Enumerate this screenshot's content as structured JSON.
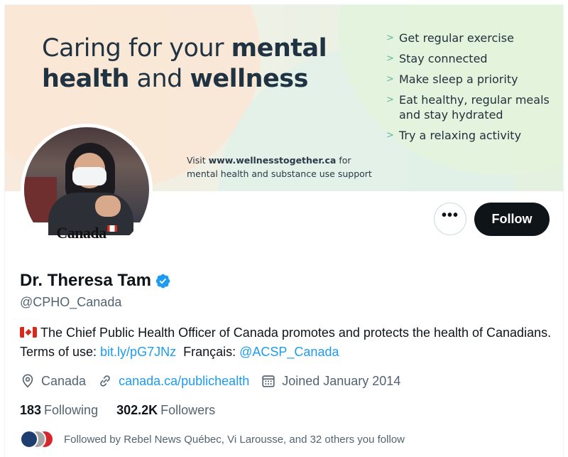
{
  "banner": {
    "title_light_1": "Caring for your ",
    "title_bold_1": "mental",
    "title_bold_2": "health",
    "title_light_2": " and ",
    "title_bold_3": "wellness",
    "tips": [
      "Get regular exercise",
      "Stay connected",
      "Make sleep a priority",
      "Eat healthy, regular meals and stay hydrated",
      "Try a relaxing activity"
    ],
    "tip_marker": ">",
    "visit_prefix": "Visit ",
    "visit_url": "www.wellnesstogether.ca",
    "visit_suffix": " for",
    "visit_line2": "mental health and substance use support"
  },
  "avatar": {
    "wordmark": "Canada"
  },
  "actions": {
    "more_label": "•••",
    "follow_label": "Follow"
  },
  "profile": {
    "name": "Dr. Theresa Tam",
    "handle": "@CPHO_Canada",
    "bio_text": "The Chief Public Health Officer of Canada promotes and protects the health of Canadians. Terms of use: ",
    "bio_link": "bit.ly/pG7JNz",
    "bio_mid": "  Français: ",
    "bio_mention": "@ACSP_Canada",
    "location": "Canada",
    "website": "canada.ca/publichealth",
    "joined": "Joined January 2014",
    "following_count": "183",
    "following_label": "Following",
    "followers_count": "302.2K",
    "followers_label": "Followers",
    "followed_by": "Followed by Rebel News Québec, Vi Larousse, and 32 others you follow"
  },
  "colors": {
    "accent": "#1d9bf0",
    "follow_bg": "#0f1419",
    "muted": "#536471"
  }
}
